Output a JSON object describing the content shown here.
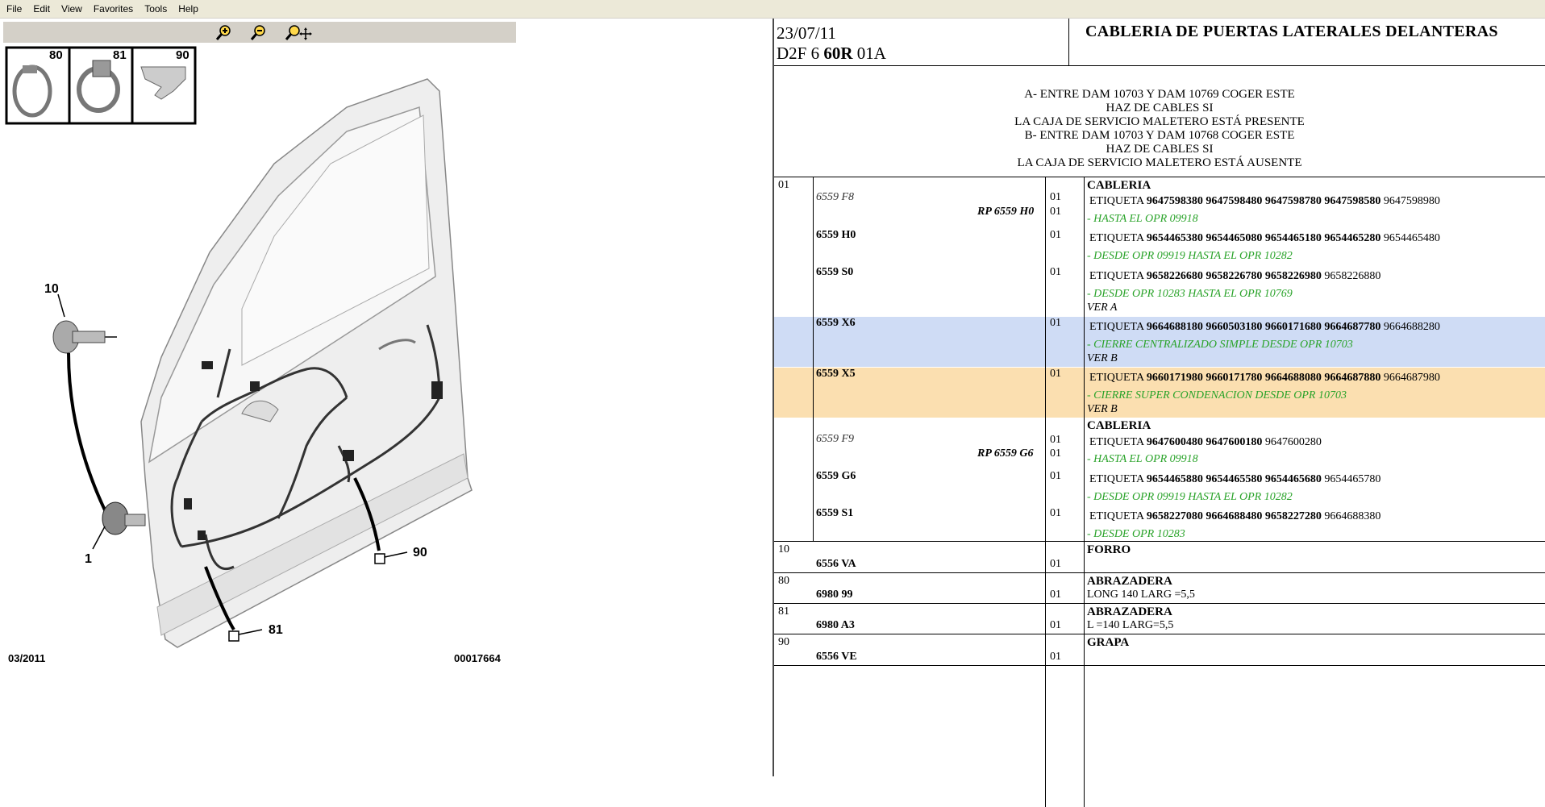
{
  "menu": [
    "File",
    "Edit",
    "View",
    "Favorites",
    "Tools",
    "Help"
  ],
  "toolbar": {
    "zoom_in": "zoom-in-icon",
    "zoom_out": "zoom-out-icon",
    "pan": "zoom-pan-icon"
  },
  "diagram": {
    "inset_labels": [
      "80",
      "81",
      "90"
    ],
    "callouts": [
      "10",
      "1",
      "90",
      "81"
    ],
    "date": "03/2011",
    "ref": "00017664"
  },
  "header": {
    "date": "23/07/11",
    "code_a": "D2F 6 ",
    "code_b": "60R",
    "code_c": " 01A",
    "title": "CABLERIA DE PUERTAS LATERALES DELANTERAS"
  },
  "notes": [
    "A- ENTRE DAM 10703 Y DAM 10769 COGER ESTE",
    "HAZ DE CABLES SI",
    "LA CAJA DE SERVICIO MALETERO ESTÁ PRESENTE",
    "B- ENTRE DAM 10703 Y DAM 10768 COGER ESTE",
    "HAZ DE CABLES SI",
    "LA CAJA DE SERVICIO MALETERO ESTÁ AUSENTE"
  ],
  "rows": {
    "r01": {
      "num": "01",
      "title": "CABLERIA",
      "ref1": "6559 F8",
      "rp1": "RP 6559 H0",
      "q1": "01",
      "q1b": "01",
      "eti1": "ETIQUETA ",
      "eti1_bold": "9647598380 9647598480 9647598780 9647598580",
      "eti1_plain": " 9647598980",
      "note1": "- HASTA EL OPR 09918",
      "ref2": "6559 H0",
      "q2": "01",
      "eti2": "ETIQUETA ",
      "eti2_bold": "9654465380 9654465080 9654465180 9654465280",
      "eti2_plain": " 9654465480",
      "note2": "- DESDE OPR 09919 HASTA EL OPR 10282",
      "ref3": "6559 S0",
      "q3": "01",
      "eti3": "ETIQUETA ",
      "eti3_bold": "9658226680 9658226780 9658226980",
      "eti3_plain": " 9658226880",
      "note3": "- DESDE OPR 10283 HASTA EL OPR 10769",
      "ver3": "VER A",
      "ref4": "6559 X6",
      "q4": "01",
      "eti4": "ETIQUETA ",
      "eti4_bold": "9664688180 9660503180 9660171680 9664687780",
      "eti4_plain": " 9664688280",
      "note4": "- CIERRE CENTRALIZADO SIMPLE DESDE OPR 10703",
      "ver4": "VER B",
      "ref5": "6559 X5",
      "q5": "01",
      "eti5": "ETIQUETA ",
      "eti5_bold": "9660171980 9660171780 9664688080 9664687880",
      "eti5_plain": " 9664687980",
      "note5": "- CIERRE SUPER CONDENACION DESDE OPR 10703",
      "ver5": "VER B",
      "title2": "CABLERIA",
      "ref6": "6559 F9",
      "rp6": "RP 6559 G6",
      "q6": "01",
      "q6b": "01",
      "eti6": "ETIQUETA ",
      "eti6_bold": "9647600480 9647600180",
      "eti6_plain": " 9647600280",
      "note6": "- HASTA EL OPR 09918",
      "ref7": "6559 G6",
      "q7": "01",
      "eti7": "ETIQUETA ",
      "eti7_bold": "9654465880 9654465580 9654465680",
      "eti7_plain": " 9654465780",
      "note7": "- DESDE OPR 09919 HASTA EL OPR 10282",
      "ref8": "6559 S1",
      "q8": "01",
      "eti8": "ETIQUETA ",
      "eti8_bold": "9658227080 9664688480 9658227280",
      "eti8_plain": " 9664688380",
      "note8": "- DESDE OPR 10283"
    },
    "r10": {
      "num": "10",
      "title": "FORRO",
      "ref": "6556 VA",
      "qty": "01"
    },
    "r80": {
      "num": "80",
      "title": "ABRAZADERA",
      "ref": "6980 99",
      "qty": "01",
      "desc": "LONG 140 LARG =5,5"
    },
    "r81": {
      "num": "81",
      "title": "ABRAZADERA",
      "ref": "6980 A3",
      "qty": "01",
      "desc": "L =140 LARG=5,5"
    },
    "r90": {
      "num": "90",
      "title": "GRAPA",
      "ref": "6556 VE",
      "qty": "01"
    }
  },
  "colors": {
    "highlight_blue": "#cfdcf5",
    "highlight_orange": "#fbdfb0",
    "note_green": "#2aa32a"
  }
}
